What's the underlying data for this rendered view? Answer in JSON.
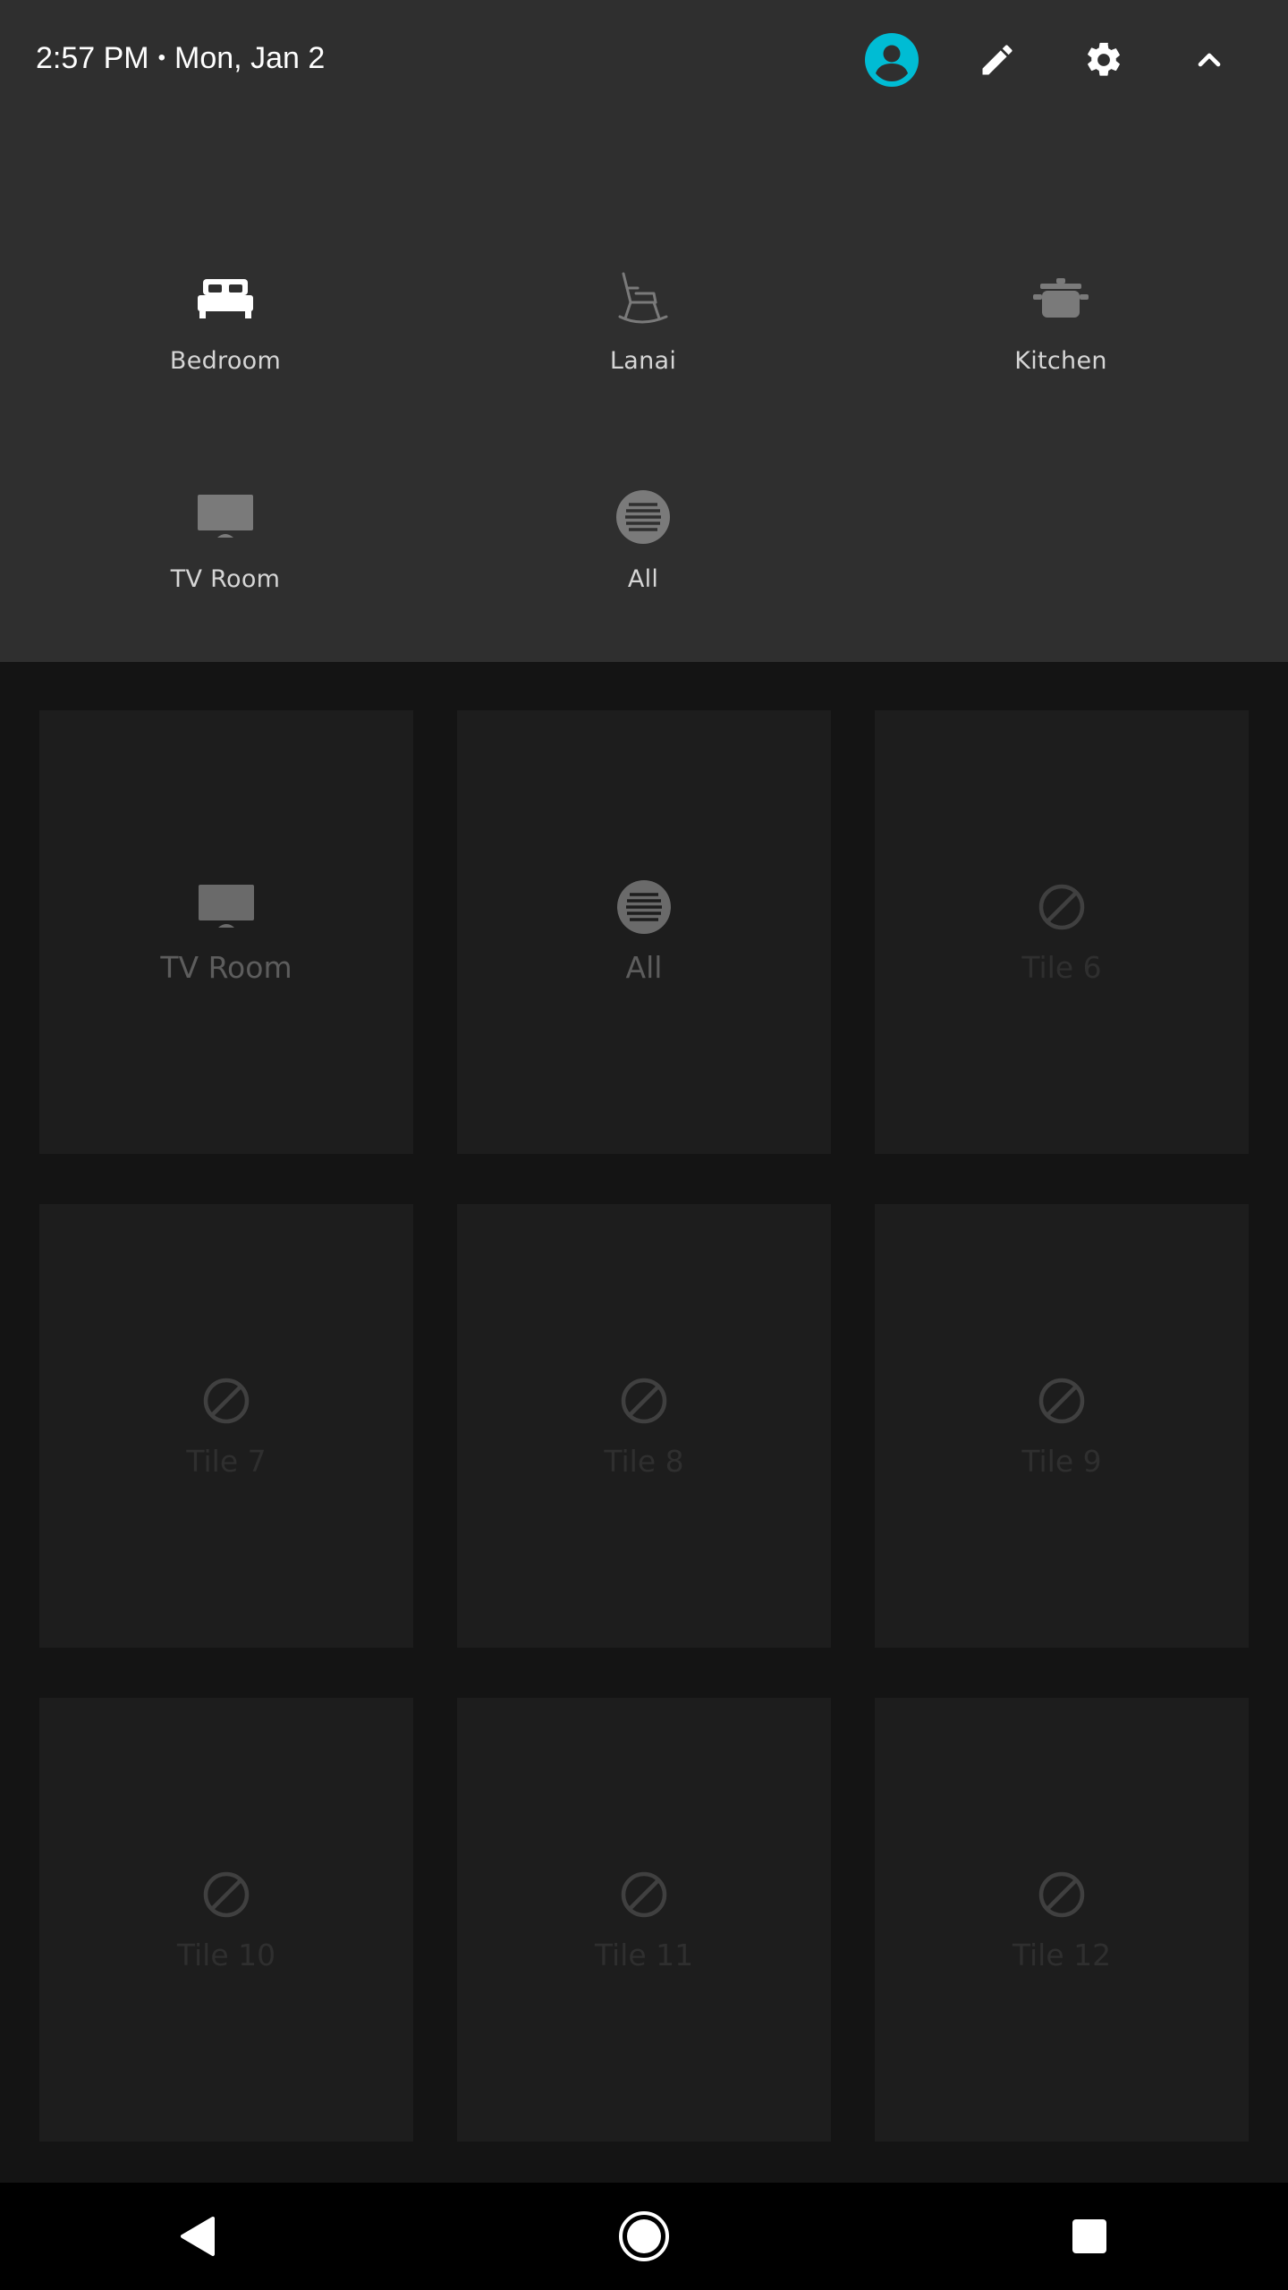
{
  "status_bar": {
    "time": "2:57 PM",
    "separator": "•",
    "date": "Mon, Jan 2"
  },
  "header_icons": [
    {
      "name": "account-icon",
      "color": "#00bcd4"
    },
    {
      "name": "edit-pencil-icon",
      "color": "#ffffff"
    },
    {
      "name": "settings-gear-icon",
      "color": "#ffffff"
    },
    {
      "name": "collapse-chevron-up-icon",
      "color": "#ffffff"
    }
  ],
  "quick_tiles": [
    {
      "label": "Bedroom",
      "icon": "bed-icon",
      "active": true
    },
    {
      "label": "Lanai",
      "icon": "rocking-chair-icon",
      "active": false
    },
    {
      "label": "Kitchen",
      "icon": "cooking-pot-icon",
      "active": false
    },
    {
      "label": "TV Room",
      "icon": "tv-icon",
      "active": false
    },
    {
      "label": "All",
      "icon": "all-lights-icon",
      "active": false
    }
  ],
  "grid_tiles": [
    {
      "label": "TV Room",
      "icon": "tv-icon",
      "enabled": true
    },
    {
      "label": "All",
      "icon": "all-lights-icon",
      "enabled": true
    },
    {
      "label": "Tile 6",
      "icon": "block-icon",
      "enabled": false
    },
    {
      "label": "Tile 7",
      "icon": "block-icon",
      "enabled": false
    },
    {
      "label": "Tile 8",
      "icon": "block-icon",
      "enabled": false
    },
    {
      "label": "Tile 9",
      "icon": "block-icon",
      "enabled": false
    },
    {
      "label": "Tile 10",
      "icon": "block-icon",
      "enabled": false
    },
    {
      "label": "Tile 11",
      "icon": "block-icon",
      "enabled": false
    },
    {
      "label": "Tile 12",
      "icon": "block-icon",
      "enabled": false
    }
  ],
  "nav_bar": [
    {
      "name": "back-icon"
    },
    {
      "name": "home-icon"
    },
    {
      "name": "recents-icon"
    }
  ],
  "colors": {
    "accent": "#00bcd4",
    "panel_bg": "#2f2f2f",
    "grid_bg": "#141414",
    "tile_bg": "#1d1d1d"
  }
}
